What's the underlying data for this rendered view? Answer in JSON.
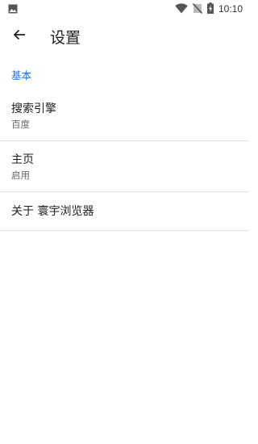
{
  "status_bar": {
    "time": "10:10",
    "icons": [
      "image-icon",
      "wifi-icon",
      "no-sim-icon",
      "battery-charging-icon"
    ]
  },
  "app_bar": {
    "back_icon": "arrow-left-icon",
    "title": "设置"
  },
  "section": {
    "header": "基本"
  },
  "preferences": [
    {
      "title": "搜索引擎",
      "summary": "百度"
    },
    {
      "title": "主页",
      "summary": "启用"
    },
    {
      "title": "关于 寰宇浏览器"
    }
  ],
  "colors": {
    "accent": "#1a73e8",
    "divider": "#e0e0e0"
  }
}
